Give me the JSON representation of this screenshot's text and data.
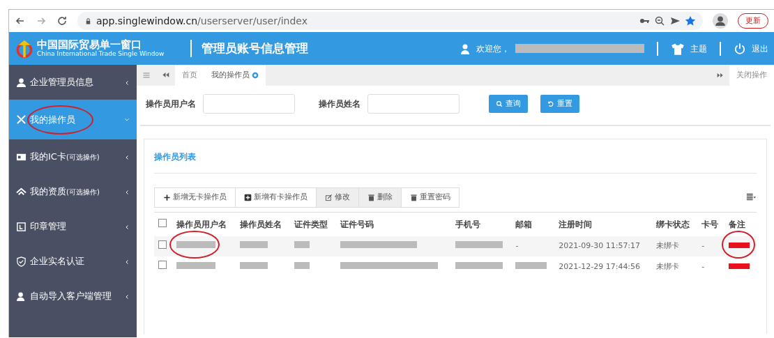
{
  "browser": {
    "url_host": "app.singlewindow.cn",
    "url_path": "/userserver/user/index",
    "update_button": "更新"
  },
  "header": {
    "logo_title": "中国国际贸易单一窗口",
    "logo_subtitle": "China International Trade Single Window",
    "page_title": "管理员账号信息管理",
    "welcome": "欢迎您，",
    "theme": "主题",
    "logout": "退出"
  },
  "sidebar": {
    "items": [
      {
        "label": "企业管理员信息",
        "selected": false,
        "circled": false
      },
      {
        "label": "我的操作员",
        "selected": true,
        "circled": true
      },
      {
        "label": "我的IC卡",
        "note": "(可选操作)",
        "selected": false,
        "circled": false
      },
      {
        "label": "我的资质",
        "note": "(可选操作)",
        "selected": false,
        "circled": false
      },
      {
        "label": "印章管理",
        "selected": false,
        "circled": false
      },
      {
        "label": "企业实名认证",
        "selected": false,
        "circled": false
      },
      {
        "label": "自动导入客户端管理",
        "selected": false,
        "circled": false
      }
    ]
  },
  "tabs": [
    {
      "label": "首页",
      "selected": false
    },
    {
      "label": "我的操作员",
      "selected": true
    }
  ],
  "close_ops": "关闭操作",
  "search": {
    "fields": [
      {
        "label": "操作员用户名"
      },
      {
        "label": "操作员姓名"
      }
    ],
    "query_button": "查询",
    "reset_button": "重置"
  },
  "list_title": "操作员列表",
  "toolbar": [
    {
      "label": "新增无卡操作员",
      "disabled": false
    },
    {
      "label": "新增有卡操作员",
      "disabled": false
    },
    {
      "label": "修改",
      "disabled": true
    },
    {
      "label": "删除",
      "disabled": true
    },
    {
      "label": "重置密码",
      "disabled": false
    }
  ],
  "table": {
    "select_all_checked": false,
    "columns": [
      "操作员用户名",
      "操作员姓名",
      "证件类型",
      "证件号码",
      "手机号",
      "邮箱",
      "注册时间",
      "绑卡状态",
      "卡号",
      "备注"
    ],
    "rows": [
      {
        "checked": false,
        "cells": [
          {
            "kind": "redacted_circled"
          },
          {
            "kind": "redacted"
          },
          {
            "kind": "redacted"
          },
          {
            "kind": "redacted"
          },
          {
            "kind": "redacted"
          },
          {
            "kind": "text",
            "text": "-"
          },
          {
            "kind": "text",
            "text": "2021-09-30 11:57:17"
          },
          {
            "kind": "text",
            "text": "未绑卡"
          },
          {
            "kind": "text",
            "text": "-"
          },
          {
            "kind": "red_circled"
          }
        ]
      },
      {
        "checked": false,
        "cells": [
          {
            "kind": "redacted"
          },
          {
            "kind": "redacted"
          },
          {
            "kind": "redacted"
          },
          {
            "kind": "redacted"
          },
          {
            "kind": "redacted"
          },
          {
            "kind": "redacted"
          },
          {
            "kind": "text",
            "text": "2021-12-29 17:44:56"
          },
          {
            "kind": "text",
            "text": "未绑卡"
          },
          {
            "kind": "text",
            "text": "-"
          },
          {
            "kind": "red"
          }
        ]
      }
    ]
  }
}
